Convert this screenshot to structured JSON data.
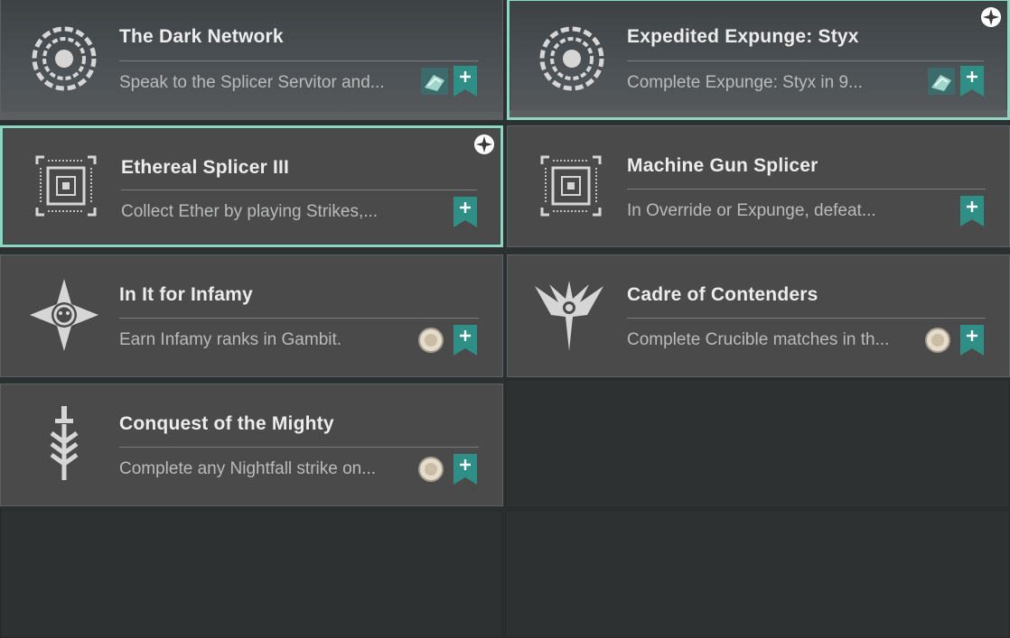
{
  "colors": {
    "accent_teal": "#2f8f86",
    "selected_border": "#8fd6c2",
    "card_bg": "#4a4a4a",
    "empty_bg": "#2e3131"
  },
  "bounties": [
    {
      "title": "The Dark Network",
      "desc": "Speak to the Splicer Servitor and...",
      "icon": "splicer-seal-icon",
      "reward": "engram-reward-icon",
      "selected": false,
      "is_new": false
    },
    {
      "title": "Expedited Expunge: Styx",
      "desc": "Complete Expunge: Styx in 9...",
      "icon": "splicer-seal-icon",
      "reward": "engram-reward-icon",
      "selected": true,
      "is_new": true
    },
    {
      "title": "Ethereal Splicer III",
      "desc": "Collect Ether by playing Strikes,...",
      "icon": "splicer-frame-icon",
      "reward": "",
      "selected": true,
      "is_new": true
    },
    {
      "title": "Machine Gun Splicer",
      "desc": "In Override or Expunge, defeat...",
      "icon": "splicer-frame-icon",
      "reward": "",
      "selected": false,
      "is_new": false
    },
    {
      "title": "In It for Infamy",
      "desc": "Earn Infamy ranks in Gambit.",
      "icon": "gambit-icon",
      "reward": "token-reward-icon",
      "selected": false,
      "is_new": false
    },
    {
      "title": "Cadre of Contenders",
      "desc": "Complete Crucible matches in th...",
      "icon": "crucible-icon",
      "reward": "token-reward-icon",
      "selected": false,
      "is_new": false
    },
    {
      "title": "Conquest of the Mighty",
      "desc": "Complete any Nightfall strike on...",
      "icon": "vanguard-icon",
      "reward": "token-reward-icon",
      "selected": false,
      "is_new": false
    }
  ]
}
